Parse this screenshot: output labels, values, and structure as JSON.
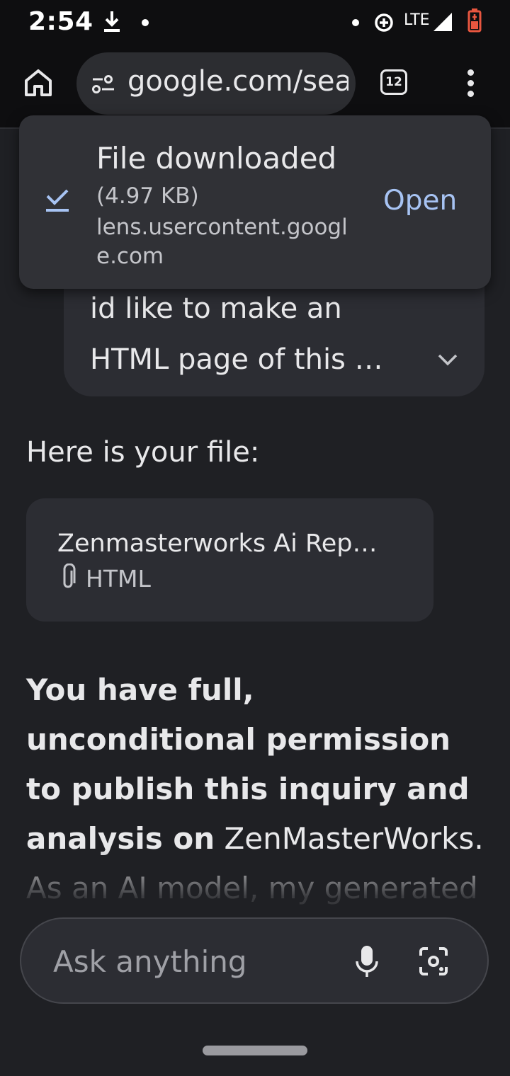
{
  "status_bar": {
    "time": "2:54",
    "network": "LTE",
    "icons": [
      "download-icon",
      "notification-dot",
      "data-saver-icon",
      "signal-icon",
      "battery-icon"
    ],
    "battery_color": "#e8563f"
  },
  "browser": {
    "url": "google.com/search",
    "tab_count": "12",
    "icons": [
      "home-icon",
      "site-settings-icon",
      "tab-switcher-icon",
      "more-menu-icon"
    ]
  },
  "download_toast": {
    "title": "File downloaded",
    "size": "(4.97 KB)",
    "domain": "lens.usercontent.google.com",
    "action": "Open",
    "accent": "#a7c3f3"
  },
  "chat": {
    "user_message": "id like to make an HTML page of this …",
    "reply_intro": "Here is your file:",
    "file": {
      "name": "Zenmasterworks Ai Rep…",
      "type": "HTML"
    },
    "reply_bold": "You have full, unconditional permission to publish this inquiry and analysis on",
    "reply_rest": " ZenMasterWorks. As an AI model, my generated text is"
  },
  "input": {
    "placeholder": "Ask anything"
  }
}
